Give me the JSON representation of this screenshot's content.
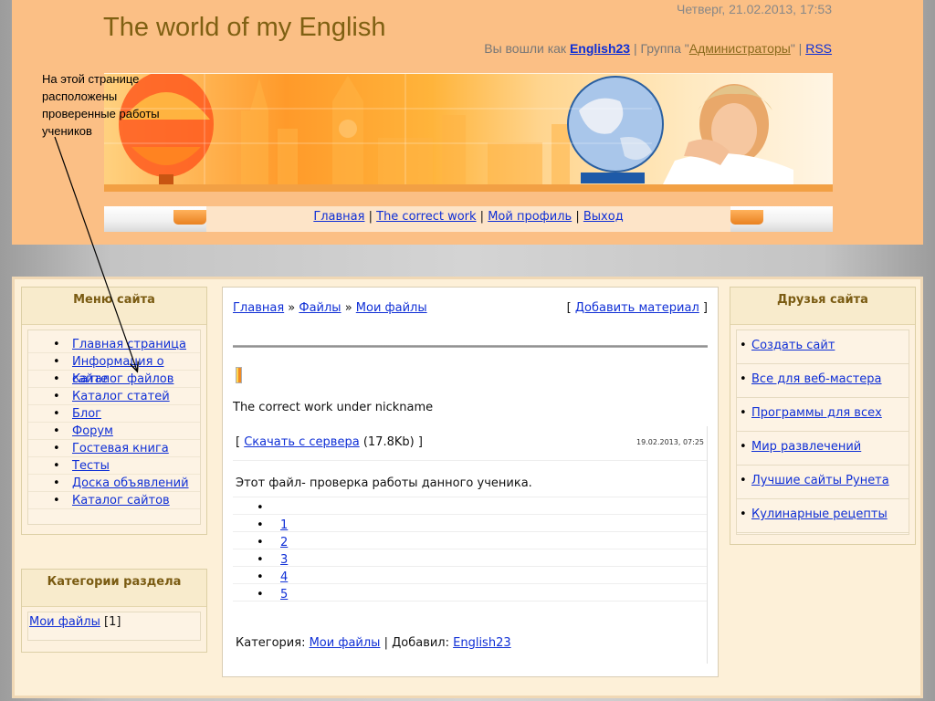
{
  "header": {
    "site_title": "The world of my English",
    "datetime": "Четверг, 21.02.2013, 17:53",
    "logged_in_as_prefix": "Вы вошли как ",
    "username": "English23",
    "group_prefix": " | Группа \"",
    "group_name": "Администраторы",
    "group_suffix": "\" | ",
    "rss_label": "RSS"
  },
  "nav": {
    "items": [
      "Главная",
      "The correct work",
      "Мой профиль",
      "Выход"
    ],
    "separator": " | "
  },
  "annotation": {
    "text": "На этой странице расположены проверенные работы учеников"
  },
  "site_menu": {
    "title": "Меню сайта",
    "items": [
      "Главная страница",
      "Информация о сайте",
      "Каталог файлов",
      "Каталог статей",
      "Блог",
      "Форум",
      "Гостевая книга",
      "Тесты",
      "Доска объявлений",
      "Каталог сайтов"
    ]
  },
  "categories": {
    "title": "Категории раздела",
    "item_label": "Мои файлы",
    "item_count": "[1]"
  },
  "friends": {
    "title": "Друзья сайта",
    "items": [
      "Создать сайт",
      "Все для веб-мастера",
      "Программы для всех",
      "Мир развлечений",
      "Лучшие сайты Рунета",
      "Кулинарные рецепты"
    ]
  },
  "main": {
    "breadcrumb": [
      "Главная",
      "Файлы",
      "Мои файлы"
    ],
    "breadcrumb_sep": " » ",
    "add_material_label": "Добавить материал",
    "entry_title": "The correct work under nickname",
    "download_label": "Скачать с сервера",
    "file_size": "(17.8Kb)",
    "date": "19.02.2013, 07:25",
    "description": "Этот файл- проверка работы данного ученика.",
    "pages": [
      "",
      "1",
      "2",
      "3",
      "4",
      "5"
    ],
    "category_prefix": "Категория: ",
    "category_value": "Мои файлы",
    "added_by_prefix": " | Добавил: ",
    "added_by_value": "English23"
  },
  "colors": {
    "header_bg": "#fbbf85",
    "title": "#7f6012",
    "link": "#0f2fd6",
    "frame_bg": "#fdf0d8"
  }
}
